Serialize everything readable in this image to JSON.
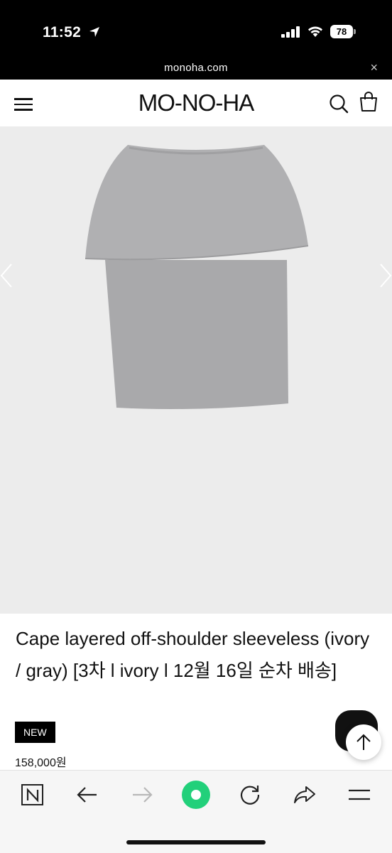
{
  "status_bar": {
    "time": "11:52",
    "battery": "78"
  },
  "url_bar": {
    "url": "monoha.com",
    "close_label": "×"
  },
  "header": {
    "logo": "MO-NO-HA"
  },
  "product": {
    "title": "Cape layered off-shoulder sleeveless (ivory / gray) [3차 l ivory l 12월 16일 순차 배송]",
    "badge": "NEW",
    "price": "158,000원"
  },
  "colors": {
    "accent_green": "#22d07a",
    "product_gray": "#a9a9ab",
    "image_bg": "#ececec"
  },
  "toolbar": {
    "icons": [
      "naver-n-icon",
      "back-arrow-icon",
      "forward-arrow-icon",
      "home-circle-icon",
      "refresh-icon",
      "share-icon",
      "menu-icon"
    ]
  }
}
